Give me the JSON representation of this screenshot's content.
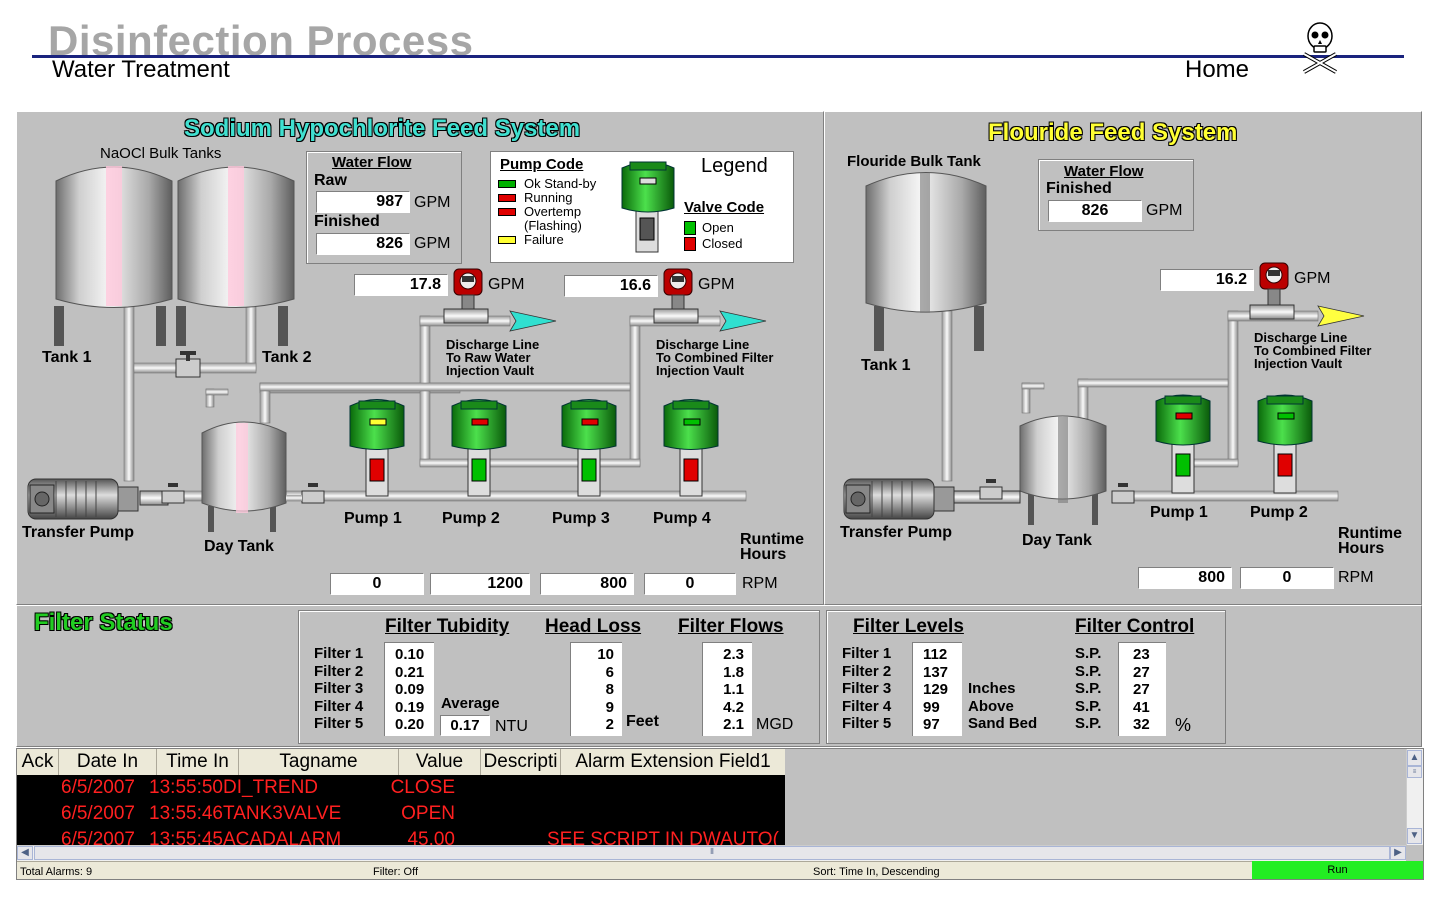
{
  "header": {
    "title": "Disinfection Process",
    "subtitle": "Water Treatment",
    "home_label": "Home",
    "rule_color": "#1a237e",
    "logo_icon": "skull-crossbones-icon"
  },
  "hypochlorite": {
    "title": "Sodium Hypochlorite Feed System",
    "bulk_tanks_label": "NaOCl Bulk Tanks",
    "tank1_label": "Tank 1",
    "tank2_label": "Tank 2",
    "day_tank_label": "Day Tank",
    "transfer_pump_label": "Transfer Pump",
    "water_flow": {
      "title": "Water Flow",
      "raw_label": "Raw",
      "raw_value": "987",
      "raw_unit": "GPM",
      "finished_label": "Finished",
      "finished_value": "826",
      "finished_unit": "GPM"
    },
    "legend": {
      "title": "Legend",
      "pump_code_title": "Pump Code",
      "pump_codes": [
        {
          "label": "Ok Stand-by",
          "color": "#00b000"
        },
        {
          "label": "Running",
          "color": "#e00000"
        },
        {
          "label": "Overtemp",
          "color": "#e00000"
        },
        {
          "label": "(Flashing)",
          "color": ""
        },
        {
          "label": "Failure",
          "color": "#ffff33"
        }
      ],
      "valve_code_title": "Valve Code",
      "valve_codes": [
        {
          "label": "Open",
          "color": "#00c000"
        },
        {
          "label": "Closed",
          "color": "#e00000"
        }
      ]
    },
    "flow_meter_1": {
      "value": "17.8",
      "unit": "GPM"
    },
    "flow_meter_2": {
      "value": "16.6",
      "unit": "GPM"
    },
    "discharge_1": {
      "line1": "Discharge Line",
      "line2": "To Raw Water",
      "line3": "Injection Vault"
    },
    "discharge_2": {
      "line1": "Discharge Line",
      "line2": "To Combined Filter",
      "line3": "Injection Vault"
    },
    "pumps": [
      {
        "label": "Pump 1",
        "indicator": "#ffff33",
        "valve": "#e00000",
        "rpm": "0"
      },
      {
        "label": "Pump 2",
        "indicator": "#e00000",
        "valve": "#00c000",
        "rpm": "1200"
      },
      {
        "label": "Pump 3",
        "indicator": "#e00000",
        "valve": "#00c000",
        "rpm": "800"
      },
      {
        "label": "Pump 4",
        "indicator": "#00c000",
        "valve": "#e00000",
        "rpm": "0"
      }
    ],
    "runtime_label_1": "Runtime",
    "runtime_label_2": "Hours",
    "rpm_unit": "RPM"
  },
  "flouride": {
    "title": "Flouride Feed System",
    "bulk_tank_label": "Flouride Bulk Tank",
    "tank1_label": "Tank 1",
    "day_tank_label": "Day Tank",
    "transfer_pump_label": "Transfer Pump",
    "water_flow": {
      "title": "Water Flow",
      "finished_label": "Finished",
      "finished_value": "826",
      "finished_unit": "GPM"
    },
    "flow_meter": {
      "value": "16.2",
      "unit": "GPM"
    },
    "discharge": {
      "line1": "Discharge Line",
      "line2": "To Combined Filter",
      "line3": "Injection Vault"
    },
    "pumps": [
      {
        "label": "Pump 1",
        "indicator": "#e00000",
        "valve": "#00c000",
        "rpm": "800"
      },
      {
        "label": "Pump 2",
        "indicator": "#00c000",
        "valve": "#e00000",
        "rpm": "0"
      }
    ],
    "runtime_label_1": "Runtime",
    "runtime_label_2": "Hours",
    "rpm_unit": "RPM"
  },
  "filter_status": {
    "title": "Filter Status",
    "filter_labels": [
      "Filter 1",
      "Filter 2",
      "Filter 3",
      "Filter 4",
      "Filter 5"
    ],
    "turbidity_title": "Filter Tubidity",
    "turbidity": [
      "0.10",
      "0.21",
      "0.09",
      "0.19",
      "0.20"
    ],
    "average_label": "Average",
    "average_value": "0.17",
    "ntu_unit": "NTU",
    "head_loss_title": "Head Loss",
    "head_loss": [
      "10",
      "6",
      "8",
      "9",
      "2"
    ],
    "feet_unit": "Feet",
    "flows_title": "Filter Flows",
    "flows": [
      "2.3",
      "1.8",
      "1.1",
      "4.2",
      "2.1"
    ],
    "mgd_unit": "MGD",
    "levels_title": "Filter Levels",
    "levels": [
      "112",
      "137",
      "129",
      "99",
      "97"
    ],
    "levels_desc": [
      "Inches",
      "Above",
      "Sand Bed"
    ],
    "control_title": "Filter Control",
    "sp_label": "S.P.",
    "control": [
      "23",
      "27",
      "27",
      "41",
      "32"
    ],
    "pct_unit": "%"
  },
  "alarms": {
    "columns": [
      "Ack",
      "Date In",
      "Time In",
      "Tagname",
      "Value",
      "Descripti",
      "Alarm Extension Field1"
    ],
    "rows": [
      {
        "ack": "",
        "date": "6/5/2007",
        "time": "13:55:50",
        "tag": "DI_TREND",
        "value": "CLOSE",
        "desc": "",
        "ext": ""
      },
      {
        "ack": "",
        "date": "6/5/2007",
        "time": "13:55:46",
        "tag": "TANK3VALVE",
        "value": "OPEN",
        "desc": "",
        "ext": ""
      },
      {
        "ack": "",
        "date": "6/5/2007",
        "time": "13:55:45",
        "tag": "ACADALARM",
        "value": "45.00",
        "desc": "",
        "ext": "SEE SCRIPT IN DWAUTO("
      }
    ],
    "total_label": "Total Alarms: 9",
    "filter_label": "Filter: Off",
    "sort_label": "Sort: Time In, Descending",
    "run_label": "Run",
    "run_color": "#22ee22"
  }
}
